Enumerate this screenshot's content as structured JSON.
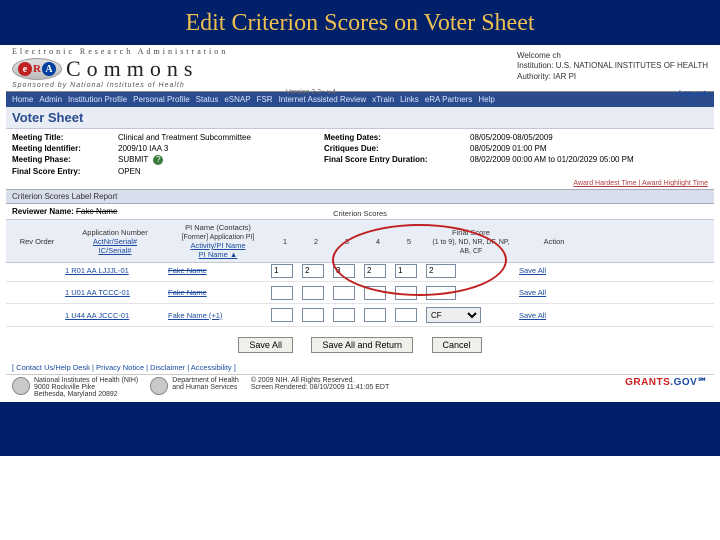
{
  "slide": {
    "title": "Edit Criterion Scores on Voter Sheet"
  },
  "banner": {
    "tagline": "Electronic Research Administration",
    "commons": "Commons",
    "sponsor": "Sponsored by National Institutes of Health",
    "version": "Version 2.2+ v.4",
    "welcome": "Welcome ch",
    "institution": "Institution: U.S. NATIONAL INSTITUTES OF HEALTH",
    "authority": "Authority: IAR PI",
    "logout": "Log-out"
  },
  "nav": {
    "items": [
      "Home",
      "Admin",
      "Institution Profile",
      "Personal Profile",
      "Status",
      "eSNAP",
      "FSR",
      "Internet Assisted Review",
      "xTrain",
      "Links",
      "eRA Partners",
      "Help"
    ]
  },
  "page": {
    "title": "Voter Sheet",
    "expert_line": "Award Hardest Time | Award Highlight Time"
  },
  "meta": {
    "meeting_title_lbl": "Meeting Title:",
    "meeting_title_val": "Clinical and Treatment Subcommittee",
    "meeting_id_lbl": "Meeting Identifier:",
    "meeting_id_val": "2009/10 IAA 3",
    "meeting_phase_lbl": "Meeting Phase:",
    "meeting_phase_val": "SUBMIT",
    "final_entry_lbl": "Final Score Entry:",
    "final_entry_val": "OPEN",
    "meeting_dates_lbl": "Meeting Dates:",
    "meeting_dates_val": "08/05/2009-08/05/2009",
    "critiques_due_lbl": "Critiques Due:",
    "critiques_due_val": "08/05/2009 01:00 PM",
    "final_dur_lbl": "Final Score Entry Duration:",
    "final_dur_val": "08/02/2009 00:00 AM  to  01/20/2029 05:00 PM"
  },
  "tab": {
    "label": "Criterion Scores Label Report"
  },
  "reviewer": {
    "label": "Reviewer Name:",
    "value": "Fake Name"
  },
  "head": {
    "rev_order": "Rev Order",
    "app_num": "Application Number",
    "app_sort1": "ActNr/Serial#",
    "app_sort2": "IC/Serial#",
    "pi": "PI Name (Contacts)",
    "pi_sub1": "[Former] Application PI]",
    "pi_sub2": "Activity/PI Name",
    "pi_sub3": "PI Name ▲",
    "scores": "Criterion Scores",
    "s1": "1",
    "s2": "2",
    "s3": "3",
    "s4": "4",
    "s5": "5",
    "final": "Final Score",
    "final_hint": "(1 to 9), ND, NR, DF, NP, AB, CF",
    "action": "Action"
  },
  "rows": [
    {
      "app": "1 R01 AA LJJJL-01",
      "pi": "Fake Name",
      "pi_strike": true,
      "s": [
        "1",
        "2",
        "3",
        "2",
        "1"
      ],
      "final_type": "text",
      "final": "2",
      "action": "Save All"
    },
    {
      "app": "1 U01 AA TCCC-01",
      "pi": "Fake Name",
      "pi_strike": true,
      "s": [
        "",
        "",
        "",
        "",
        ""
      ],
      "final_type": "text",
      "final": "",
      "action": "Save All"
    },
    {
      "app": "1 U44 AA JCCC-01",
      "pi": "Fake Name (+1)",
      "pi_strike": false,
      "s": [
        "",
        "",
        "",
        "",
        ""
      ],
      "final_type": "select",
      "final": "CF",
      "action": "Save All"
    }
  ],
  "buttons": {
    "save_all": "Save All",
    "save_return": "Save All and Return",
    "cancel": "Cancel"
  },
  "footer": {
    "links": "[ Contact Us/Help Desk | Privacy Notice | Disclaimer | Accessibility ]",
    "block1": "National Institutes of Health (NIH)\n9000 Rockville Pike\nBethesda, Maryland 20892",
    "block2": "Department of Health\nand Human Services",
    "block3": "© 2009 NIH. All Rights Reserved.\nScreen Rendered: 08/10/2009 11:41:05 EDT",
    "grants": "GRANTS",
    "gov": ".GOV℠"
  }
}
